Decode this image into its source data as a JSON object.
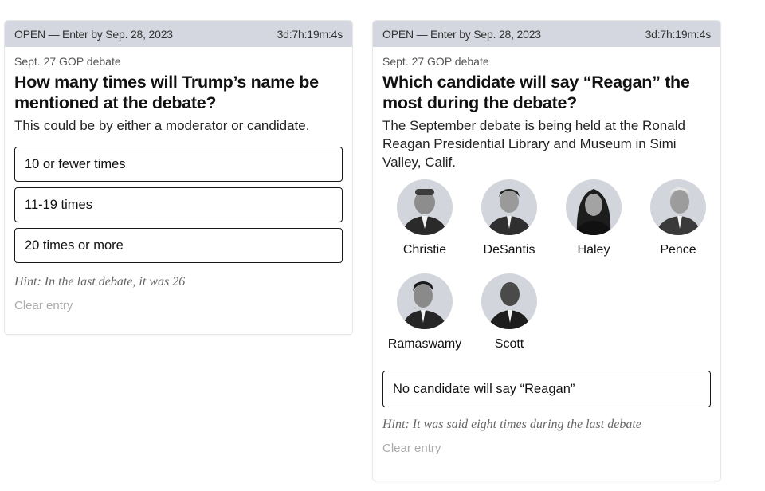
{
  "cards": [
    {
      "status": "OPEN — Enter by Sep. 28, 2023",
      "countdown": "3d:7h:19m:4s",
      "kicker": "Sept. 27 GOP debate",
      "question": "How many times will Trump’s name be mentioned at the debate?",
      "description": "This could be by either a moderator or candidate.",
      "options": [
        "10 or fewer times",
        "11-19 times",
        "20 times or more"
      ],
      "hint": "Hint: In the last debate, it was 26",
      "clear": "Clear entry"
    },
    {
      "status": "OPEN — Enter by Sep. 28, 2023",
      "countdown": "3d:7h:19m:4s",
      "kicker": "Sept. 27 GOP debate",
      "question": "Which candidate will say “Reagan” the most during the debate?",
      "description": "The September debate is being held at the Ronald Reagan Presidential Library and Museum in Simi Valley, Calif.",
      "candidates": [
        {
          "name": "Christie",
          "icon": "christie-portrait"
        },
        {
          "name": "DeSantis",
          "icon": "desantis-portrait"
        },
        {
          "name": "Haley",
          "icon": "haley-portrait"
        },
        {
          "name": "Pence",
          "icon": "pence-portrait"
        },
        {
          "name": "Ramaswamy",
          "icon": "ramaswamy-portrait"
        },
        {
          "name": "Scott",
          "icon": "scott-portrait"
        }
      ],
      "none_option": "No candidate will say “Reagan”",
      "hint": "Hint: It was said eight times during the last debate",
      "clear": "Clear entry"
    }
  ],
  "colors": {
    "header_bg": "#d4d7df",
    "avatar_bg": "#d2d5dc",
    "text": "#1a1a1a",
    "muted": "#aaaaaa"
  }
}
